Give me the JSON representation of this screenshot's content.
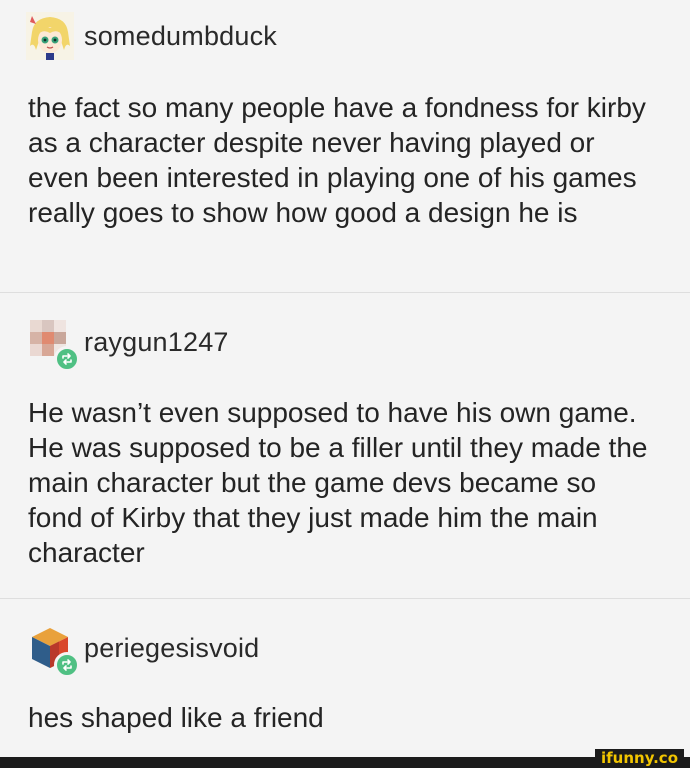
{
  "posts": [
    {
      "username": "somedumbduck",
      "avatar_icon": "anime-character-avatar-icon",
      "reblog": false,
      "text": "the fact so many people have a fondness for kirby as a character despite never having played or even been interested in playing one of his games really goes to show how good a design he is"
    },
    {
      "username": "raygun1247",
      "avatar_icon": "pixelated-avatar-icon",
      "reblog": true,
      "text": "He wasn’t even supposed to have his own game. He was supposed to be a filler until they made the main character but the game devs became so fond of Kirby that they just made him the main character"
    },
    {
      "username": "periegesisvoid",
      "avatar_icon": "cube-avatar-icon",
      "reblog": true,
      "text": "hes shaped like a friend"
    }
  ],
  "watermark": "ifunny.co",
  "colors": {
    "background": "#f4f4f4",
    "reblog_badge": "#4fc083",
    "watermark": "#f2c500"
  }
}
